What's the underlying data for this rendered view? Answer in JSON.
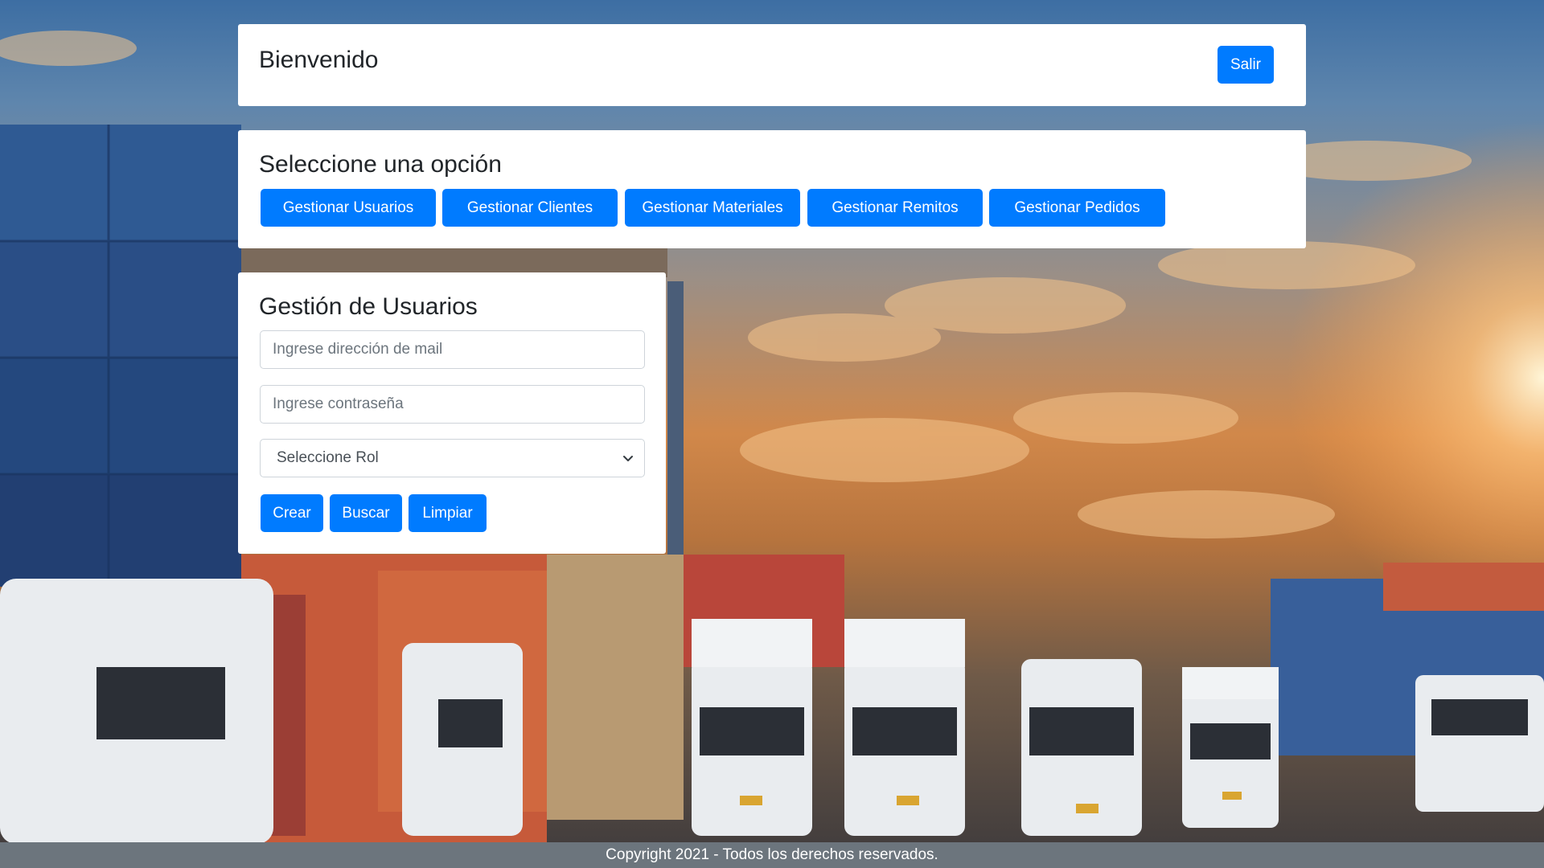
{
  "header": {
    "title": "Bienvenido",
    "logout_label": "Salir"
  },
  "options": {
    "title": "Seleccione una opción",
    "buttons": [
      {
        "label": "Gestionar Usuarios"
      },
      {
        "label": "Gestionar Clientes"
      },
      {
        "label": "Gestionar Materiales"
      },
      {
        "label": "Gestionar Remitos"
      },
      {
        "label": "Gestionar Pedidos"
      }
    ]
  },
  "users": {
    "title": "Gestión de Usuarios",
    "email_placeholder": "Ingrese dirección de mail",
    "password_placeholder": "Ingrese contraseña",
    "role_selected": "Seleccione Rol",
    "create_label": "Crear",
    "search_label": "Buscar",
    "clear_label": "Limpiar"
  },
  "footer": {
    "text": "Copyright 2021 - Todos los derechos reservados."
  },
  "colors": {
    "primary": "#007bff",
    "footer_bg": "#6c757d",
    "card_bg": "#ffffff"
  }
}
